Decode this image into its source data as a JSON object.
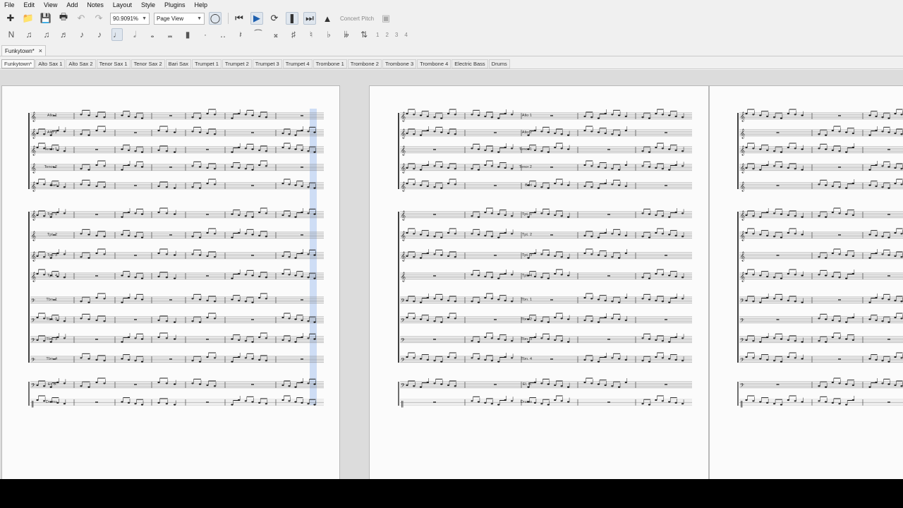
{
  "menu": [
    "File",
    "Edit",
    "View",
    "Add",
    "Notes",
    "Layout",
    "Style",
    "Plugins",
    "Help"
  ],
  "toolbar": {
    "zoom_value": "90.9091%",
    "view_mode": "Page View",
    "concert_pitch": "Concert Pitch",
    "voices": [
      "1",
      "2",
      "3",
      "4"
    ]
  },
  "tabs": {
    "document": "Funkytown*",
    "parts": [
      "Funkytown*",
      "Alto Sax 1",
      "Alto Sax 2",
      "Tenor Sax 1",
      "Tenor Sax 2",
      "Bari Sax",
      "Trumpet 1",
      "Trumpet 2",
      "Trumpet 3",
      "Trumpet 4",
      "Trombone 1",
      "Trombone 2",
      "Trombone 3",
      "Trombone 4",
      "Electric Bass",
      "Drums"
    ],
    "selected_part": 0
  },
  "score": {
    "instrument_abbreviations": [
      "Alto 1",
      "Alto 2",
      "Tenor 1",
      "Tenor 2",
      "Bari",
      "Tpt. 1",
      "Tpt. 2",
      "Tpt. 3",
      "Tpt. 4",
      "Tbn. 1",
      "Tbn. 2",
      "Tbn. 3",
      "Tbn. 4",
      "El. B.",
      "Drums"
    ],
    "clefs": [
      "treble",
      "treble",
      "treble",
      "treble",
      "treble",
      "treble",
      "treble",
      "treble",
      "treble",
      "bass",
      "bass",
      "bass",
      "bass",
      "bass",
      "percussion"
    ],
    "page_count_visible": 3
  },
  "colors": {
    "selection_highlight": "#a9c4f0",
    "page_background": "#fbfbfb",
    "canvas_background": "#dcdcdc"
  }
}
